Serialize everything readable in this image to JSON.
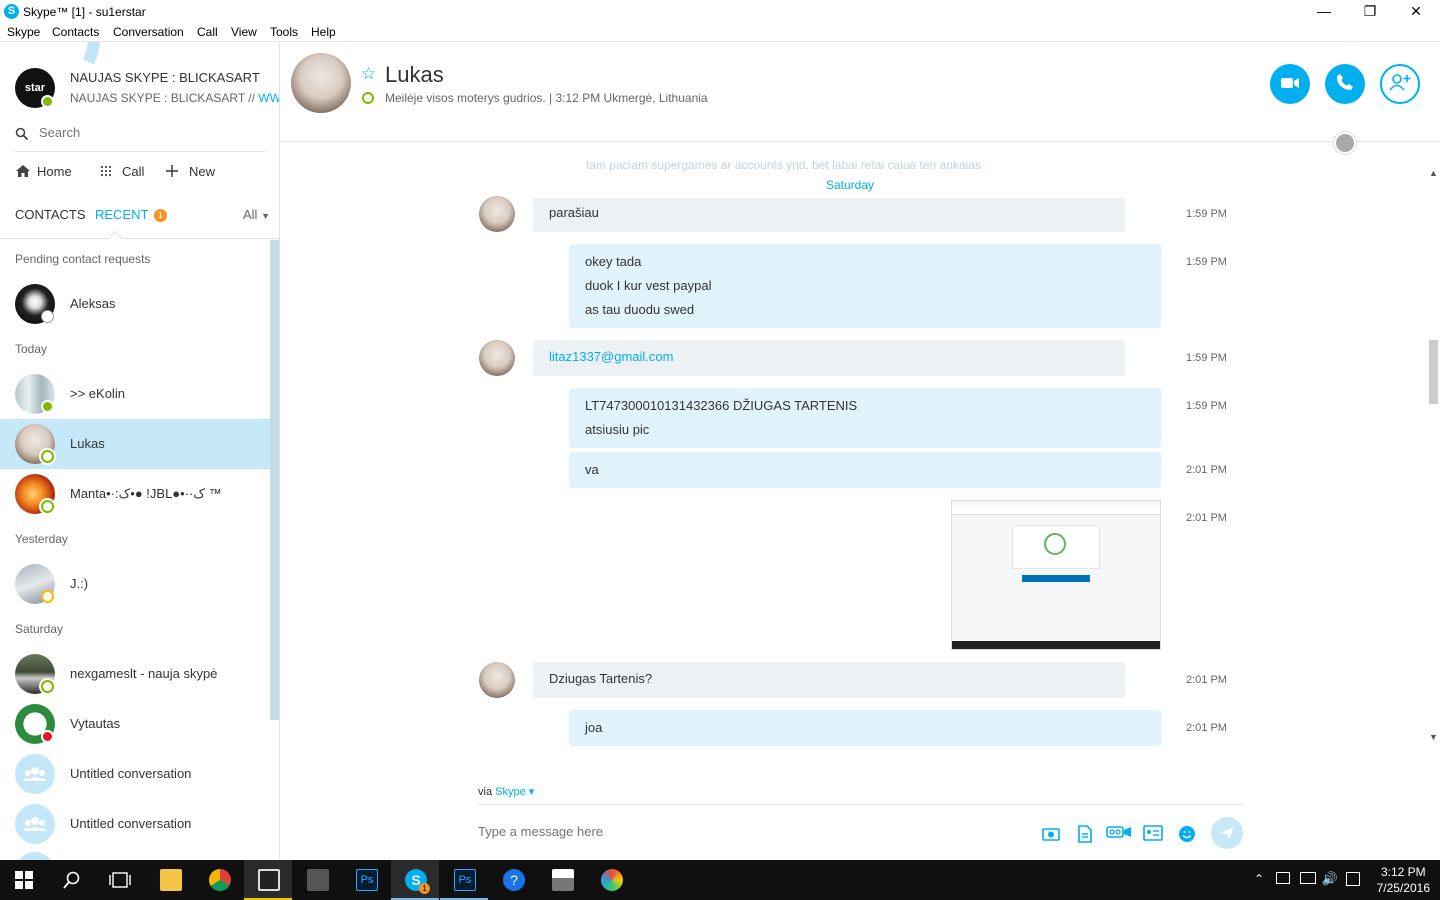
{
  "window": {
    "title": "Skype™ [1] - su1erstar",
    "app_icon_glyph": "S",
    "minimize_glyph": "—",
    "maximize_glyph": "❐",
    "close_glyph": "✕"
  },
  "menu": [
    "Skype",
    "Contacts",
    "Conversation",
    "Call",
    "View",
    "Tools",
    "Help"
  ],
  "profile": {
    "avatar_text": "star",
    "name": "NAUJAS SKYPE : BLICKASART",
    "mood": "NAUJAS SKYPE : BLICKASART // ",
    "mood_link": "WW..."
  },
  "search": {
    "placeholder": "Search"
  },
  "nav": {
    "home": "Home",
    "call": "Call",
    "new": "New"
  },
  "tabs": {
    "contacts": "CONTACTS",
    "recent": "RECENT",
    "recent_badge": "1",
    "filter": "All"
  },
  "sections": {
    "pending": "Pending contact requests",
    "today": "Today",
    "yesterday": "Yesterday",
    "saturday": "Saturday"
  },
  "contacts": [
    {
      "name": "Aleksas",
      "status": "pending"
    },
    {
      "name": ">> eKolin",
      "status": "online"
    },
    {
      "name": "Lukas",
      "status": "offline",
      "selected": true
    },
    {
      "name": "Manta•·:ک•● !JBL●•··ک ™",
      "status": "offline"
    },
    {
      "name": "J.:)",
      "status": "away"
    },
    {
      "name": "nexgameslt - nauja skypė",
      "status": "offline"
    },
    {
      "name": "Vytautas",
      "status": "dnd"
    },
    {
      "name": "Untitled conversation",
      "status": "group"
    },
    {
      "name": "Untitled conversation",
      "status": "group"
    }
  ],
  "chat": {
    "name": "Lukas",
    "mood": "Meilėje visos moterys gudrios.  |  3:12 PM Ukmergė, Lithuania",
    "faded_previous": "tam paciam supergames ar accounts ynd, bet labai retai caiua teri ankaias",
    "day_separator": "Saturday",
    "messages": [
      {
        "dir": "in",
        "lines": [
          "parašiau"
        ],
        "time": "1:59 PM"
      },
      {
        "dir": "out",
        "lines": [
          "okey tada",
          "duok I kur vest paypal",
          "as tau duodu swed"
        ],
        "time": "1:59 PM"
      },
      {
        "dir": "in",
        "lines": [
          "litaz1337@gmail.com"
        ],
        "link": true,
        "time": "1:59 PM"
      },
      {
        "dir": "out",
        "lines": [
          "LT747300010131432366 DŽIUGAS TARTENIS",
          "atsiusiu pic"
        ],
        "time": "1:59 PM"
      },
      {
        "dir": "out",
        "lines": [
          "va"
        ],
        "time": "2:01 PM"
      },
      {
        "dir": "out-image",
        "time": "2:01 PM"
      },
      {
        "dir": "in",
        "lines": [
          "Dziugas Tartenis?"
        ],
        "time": "2:01 PM"
      },
      {
        "dir": "out",
        "lines": [
          "joa"
        ],
        "time": "2:01 PM"
      }
    ]
  },
  "compose": {
    "via_prefix": "via",
    "via_service": "Skype ▾",
    "placeholder": "Type a message here"
  },
  "taskbar": {
    "time": "3:12 PM",
    "date": "7/25/2016",
    "skype_badge": "1"
  },
  "colors": {
    "accent": "#00aff0",
    "selected_row": "#c5e9f9",
    "incoming_bubble": "#eef1f4",
    "outgoing_bubble": "#e1f4fd",
    "badge": "#f7941d",
    "online": "#7fba00",
    "away": "#fdb813",
    "dnd": "#e81123"
  }
}
